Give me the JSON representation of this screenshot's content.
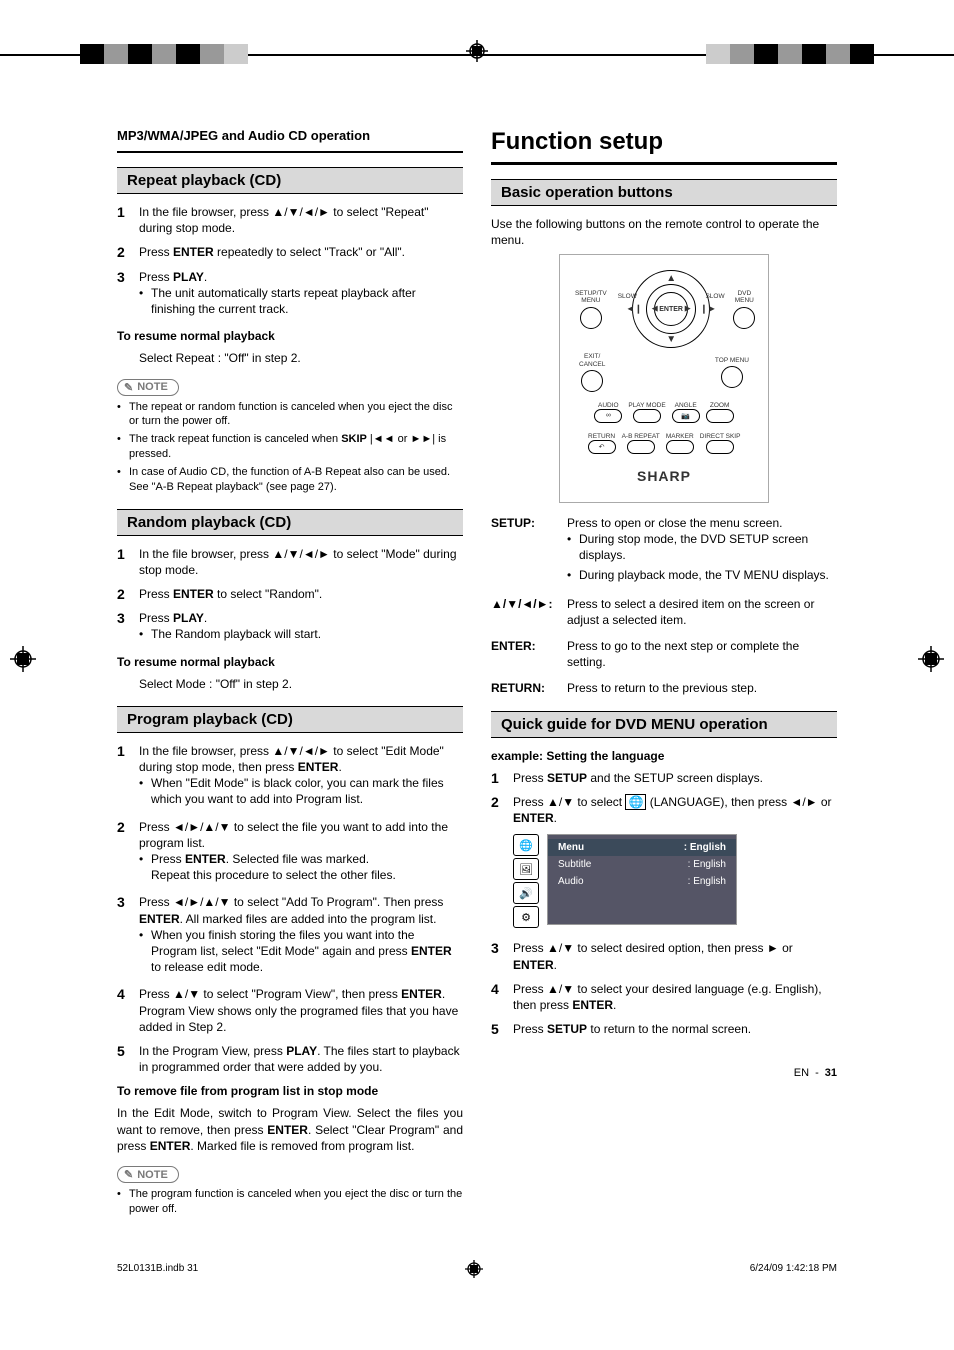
{
  "left_header": "MP3/WMA/JPEG and Audio CD operation",
  "right_header": "Function setup",
  "repeat": {
    "title": "Repeat playback (CD)",
    "steps": [
      "In the file browser, press ▲/▼/◄/► to select \"Repeat\" during stop mode.",
      "Press ENTER repeatedly to select \"Track\" or \"All\".",
      "Press PLAY."
    ],
    "step3_bullet": "The unit automatically starts repeat playback after finishing the current track.",
    "resume_h": "To resume normal playback",
    "resume_t": "Select Repeat : \"Off\" in step 2.",
    "note_label": "NOTE",
    "notes": [
      "The repeat or random function is canceled when you eject the disc or turn the power off.",
      "The track repeat function is canceled when SKIP |◄◄ or ►►| is pressed.",
      "In case of Audio CD, the function of A-B Repeat also can be used. See \"A-B Repeat playback\" (see page 27)."
    ]
  },
  "random": {
    "title": "Random playback (CD)",
    "steps": [
      "In the file browser, press ▲/▼/◄/► to select \"Mode\" during stop mode.",
      "Press ENTER to select \"Random\".",
      "Press PLAY."
    ],
    "step3_bullet": "The Random playback will start.",
    "resume_h": "To resume normal playback",
    "resume_t": "Select Mode : \"Off\" in step 2."
  },
  "program": {
    "title": "Program playback (CD)",
    "steps": [
      "In the file browser, press ▲/▼/◄/► to select \"Edit Mode\" during stop mode, then press ENTER.",
      "Press ◄/►/▲/▼ to select the file you want to add into the program list.",
      "Press ◄/►/▲/▼ to select \"Add To Program\". Then press ENTER. All marked files are added into the program list.",
      "Press ▲/▼ to select \"Program View\", then press ENTER. Program View shows only the programed files that you have added in Step 2.",
      "In the Program View, press PLAY. The files start to playback in programmed order that were added by you."
    ],
    "s1_bullet": "When \"Edit Mode\" is black color, you can mark the files which you want to add into Program list.",
    "s2_bullet_a": "Press ENTER. Selected file was marked.",
    "s2_bullet_b": "Repeat this procedure to select the other files.",
    "s3_bullet": "When you finish storing the files you want into the Program list, select \"Edit Mode\" again and press ENTER to release edit mode.",
    "remove_h": "To remove file from program list in stop mode",
    "remove_t": "In the Edit Mode, switch to Program View. Select the files you want to remove, then press ENTER. Select \"Clear Program\" and press ENTER. Marked file is removed from program list.",
    "note_label": "NOTE",
    "notes": [
      "The program function is canceled when you eject the disc or turn the power off."
    ]
  },
  "basic": {
    "title": "Basic operation buttons",
    "intro": "Use the following buttons on the remote control to operate the menu.",
    "remote": {
      "setup": "SETUP/TV MENU",
      "dvd": "DVD MENU",
      "slow": "SLOW",
      "enter": "ENTER",
      "exit": "EXIT/\nCANCEL",
      "top": "TOP MENU",
      "r2a": "AUDIO",
      "r2b": "PLAY MODE",
      "r2c": "ANGLE",
      "r2d": "ZOOM",
      "r3a": "RETURN",
      "r3b": "A-B REPEAT",
      "r3c": "MARKER",
      "r3d": "DIRECT SKIP",
      "brand": "SHARP"
    },
    "rows": [
      {
        "label": "SETUP:",
        "text": "Press to open or close the menu screen.",
        "bullets": [
          "During stop mode, the DVD SETUP screen displays.",
          "During playback mode, the TV MENU displays."
        ]
      },
      {
        "label": "▲/▼/◄/►:",
        "text": "Press to select a desired item on the screen or adjust a selected item."
      },
      {
        "label": "ENTER:",
        "text": "Press to go to the next step or complete the setting."
      },
      {
        "label": "RETURN:",
        "text": "Press to return to the previous step."
      }
    ]
  },
  "quick": {
    "title": "Quick guide for DVD MENU operation",
    "example": "example: Setting the language",
    "steps": [
      "Press SETUP and the SETUP screen displays.",
      "Press ▲/▼ to select 🌐 (LANGUAGE), then press ◄/► or ENTER.",
      "Press ▲/▼ to select desired option, then press ► or ENTER.",
      "Press ▲/▼ to select your desired language (e.g. English), then press ENTER.",
      "Press SETUP to return to the normal screen."
    ],
    "osd": {
      "menu": "Menu",
      "subtitle": "Subtitle",
      "audio": "Audio",
      "val": ": English"
    }
  },
  "footer": {
    "file": "52L0131B.indb   31",
    "time": "6/24/09   1:42:18 PM",
    "en": "EN",
    "page": "31"
  }
}
